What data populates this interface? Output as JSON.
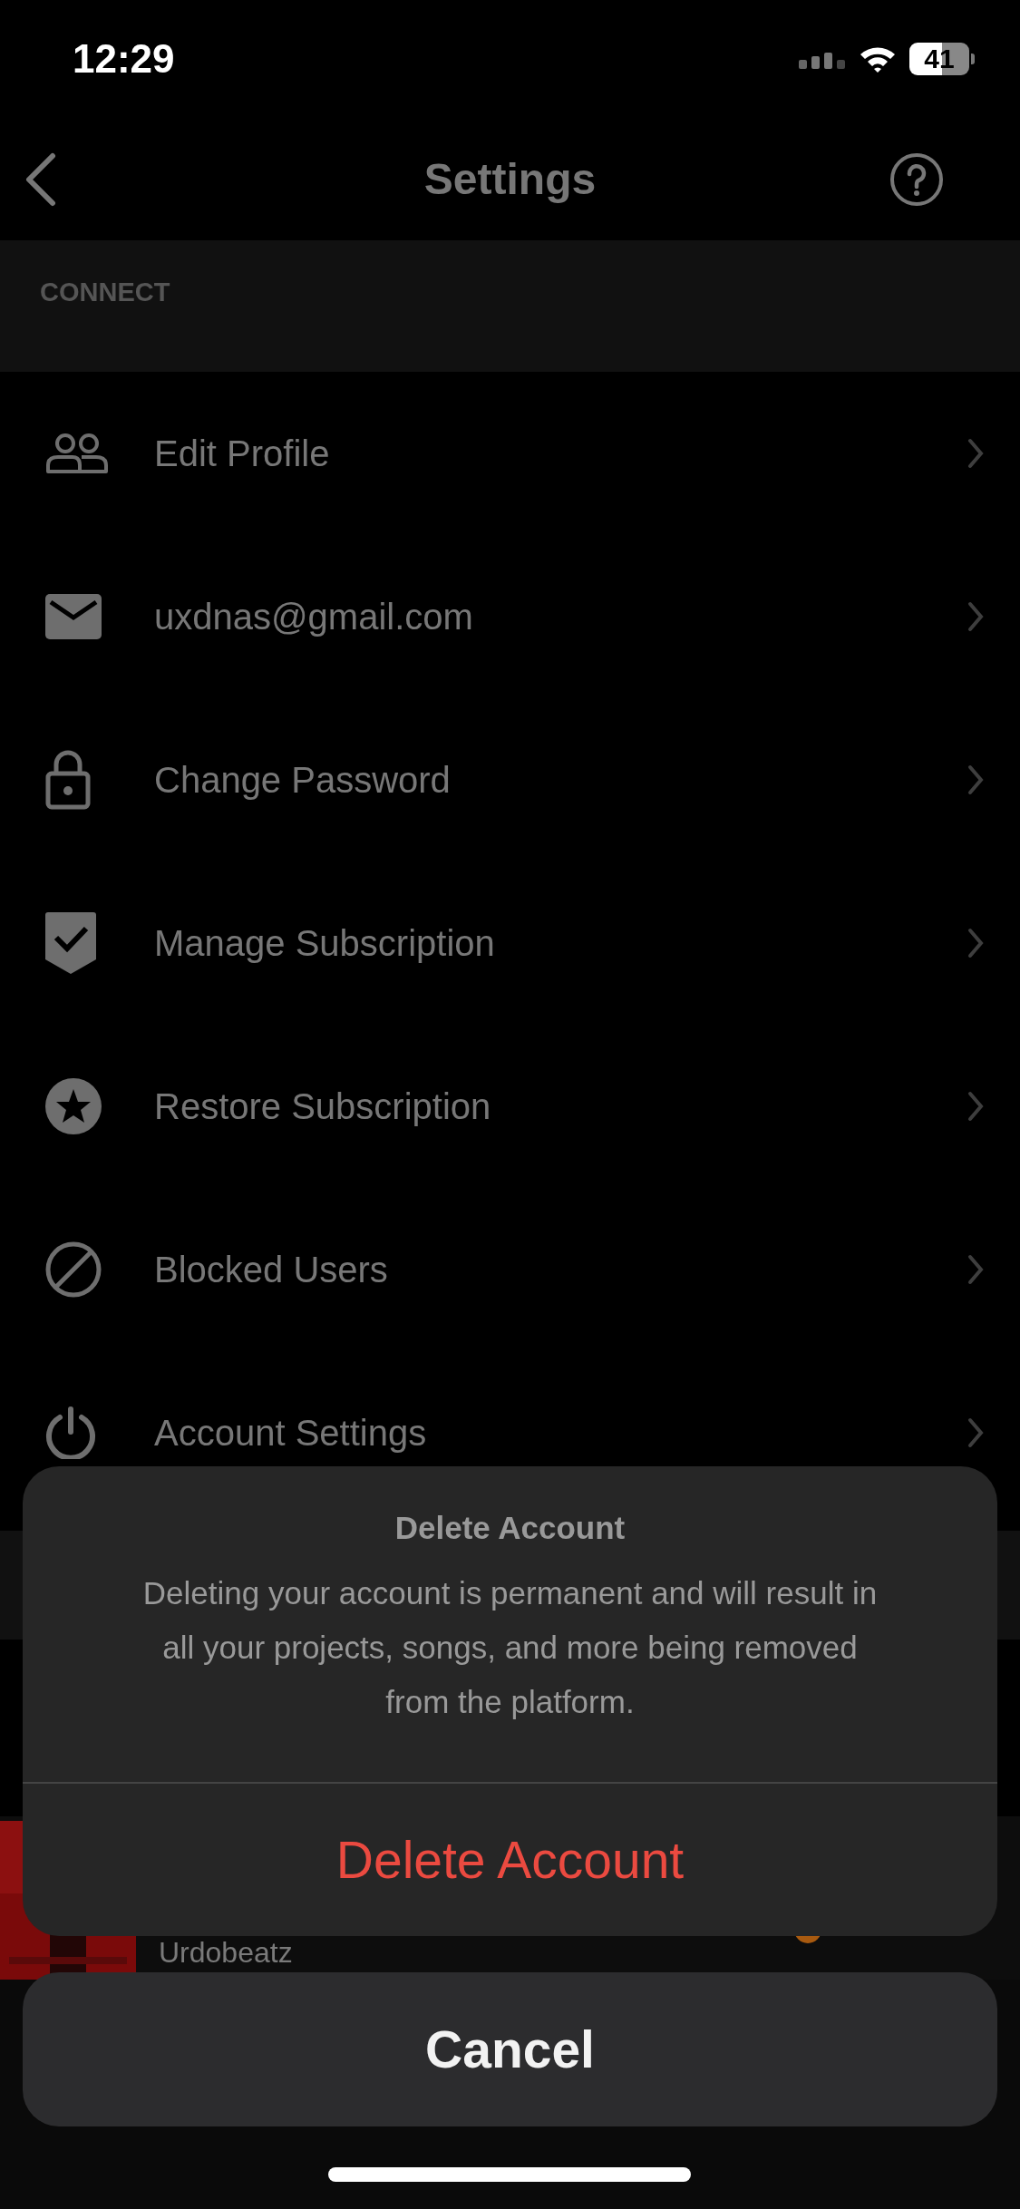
{
  "status_bar": {
    "time": "12:29",
    "battery": "41"
  },
  "nav": {
    "title": "Settings"
  },
  "section": {
    "title": "CONNECT"
  },
  "items": [
    {
      "label": "Edit Profile"
    },
    {
      "label": "uxdnas@gmail.com"
    },
    {
      "label": "Change Password"
    },
    {
      "label": "Manage Subscription"
    },
    {
      "label": "Restore Subscription"
    },
    {
      "label": "Blocked Users"
    },
    {
      "label": "Account Settings"
    }
  ],
  "mini_player": {
    "artist": "Urdobeatz"
  },
  "action_sheet": {
    "title": "Delete Account",
    "message": "Deleting your account is permanent and will result in all your projects, songs, and more being removed from the platform.",
    "actions": [
      {
        "label": "Delete Account",
        "kind": "destructive"
      }
    ],
    "cancel": "Cancel"
  }
}
